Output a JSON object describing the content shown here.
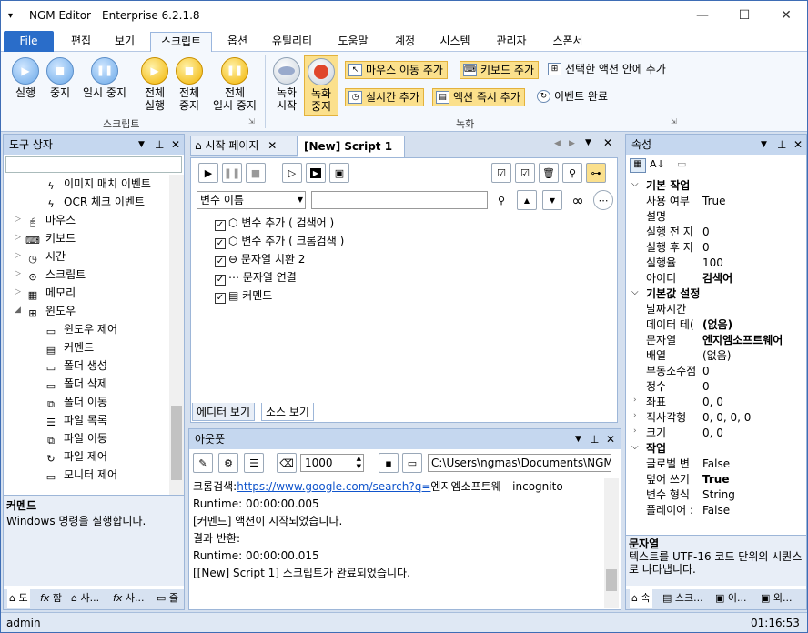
{
  "app": {
    "name": "NGM Editor",
    "edition": "Enterprise 6.2.1.8"
  },
  "menu": {
    "file": "File",
    "items": [
      "편집",
      "보기",
      "스크립트",
      "옵션",
      "유틸리티",
      "도움말",
      "계정",
      "시스템",
      "관리자",
      "스폰서"
    ],
    "active": "스크립트"
  },
  "ribbon": {
    "script_group": {
      "label": "스크립트",
      "buttons": [
        {
          "l1": "실행",
          "l2": ""
        },
        {
          "l1": "중지",
          "l2": ""
        },
        {
          "l1": "일시 중지",
          "l2": ""
        },
        {
          "l1": "전체",
          "l2": "실행"
        },
        {
          "l1": "전체",
          "l2": "중지"
        },
        {
          "l1": "전체",
          "l2": "일시 중지"
        }
      ]
    },
    "record_group": {
      "label": "녹화",
      "start": {
        "l1": "녹화",
        "l2": "시작"
      },
      "stop": {
        "l1": "녹화",
        "l2": "중지"
      },
      "small": [
        "마우스 이동 추가",
        "키보드 추가",
        "선택한 액션 안에 추가",
        "실시간 추가",
        "액션 즉시 추가",
        "이벤트 완료"
      ]
    }
  },
  "toolbox": {
    "title": "도구 상자",
    "items": [
      {
        "label": "이미지 매치 이벤트",
        "icon": "lightning-icon",
        "glyph": "ϟ"
      },
      {
        "label": "OCR 체크 이벤트",
        "icon": "lightning-icon",
        "glyph": "ϟ"
      },
      {
        "label": "마우스",
        "icon": "mouse-icon",
        "glyph": "🖰"
      },
      {
        "label": "키보드",
        "icon": "keyboard-icon",
        "glyph": "⌨"
      },
      {
        "label": "시간",
        "icon": "clock-icon",
        "glyph": "◷"
      },
      {
        "label": "스크립트",
        "icon": "script-icon",
        "glyph": "⊙"
      },
      {
        "label": "메모리",
        "icon": "memory-icon",
        "glyph": "▦"
      },
      {
        "label": "윈도우",
        "icon": "windows-icon",
        "glyph": "⊞"
      },
      {
        "label": "윈도우 제어",
        "icon": "window-control-icon",
        "glyph": "▭"
      },
      {
        "label": "커멘드",
        "icon": "cmd-icon",
        "glyph": "▤"
      },
      {
        "label": "폴더 생성",
        "icon": "folder-icon",
        "glyph": "▭"
      },
      {
        "label": "폴더 삭제",
        "icon": "folder-icon",
        "glyph": "▭"
      },
      {
        "label": "폴더 이동",
        "icon": "folder-move-icon",
        "glyph": "⧉"
      },
      {
        "label": "파일 목록",
        "icon": "file-list-icon",
        "glyph": "☰"
      },
      {
        "label": "파일 이동",
        "icon": "file-move-icon",
        "glyph": "⧉"
      },
      {
        "label": "파일 제어",
        "icon": "file-control-icon",
        "glyph": "↻"
      },
      {
        "label": "모니터 제어",
        "icon": "monitor-icon",
        "glyph": "▭"
      }
    ],
    "desc_title": "커멘드",
    "desc_text": "Windows 명령을 실행합니다.",
    "tabs": [
      "도",
      "함",
      "사...",
      "사...",
      "즐"
    ]
  },
  "editor": {
    "tabs": [
      "시작 페이지",
      "[New] Script 1"
    ],
    "var_select": "변수 이름",
    "actions": [
      "변수 추가 ( 검색어 )",
      "변수 추가 ( 크롬검색 )",
      "문자열 치환 2",
      "문자열 연결",
      "커멘드"
    ],
    "bottom_tabs": [
      "에디터 보기",
      "소스 보기"
    ]
  },
  "output": {
    "title": "아웃풋",
    "count": "1000",
    "path": "C:\\Users\\ngmas\\Documents\\NGM6\\",
    "line1_pre": "크롬검색:",
    "line1_link": "https://www.google.com/search?q=",
    "line1_post": "엔지엠소프트웨 --incognito",
    "lines": [
      "Runtime: 00:00:00.005",
      "[커멘드] 액션이 시작되었습니다.",
      "결과 반환:",
      "Runtime: 00:00:00.015",
      "[[New] Script 1] 스크립트가 완료되었습니다."
    ]
  },
  "props": {
    "title": "속성",
    "cat1": "기본 작업",
    "rows1": [
      {
        "k": "사용 여부",
        "v": "True"
      },
      {
        "k": "설명",
        "v": ""
      },
      {
        "k": "실행 전 지",
        "v": "0"
      },
      {
        "k": "실행 후 지",
        "v": "0"
      },
      {
        "k": "실행율",
        "v": "100"
      },
      {
        "k": "아이디",
        "v": "검색어"
      }
    ],
    "cat2": "기본값 설정",
    "rows2": [
      {
        "k": "날짜시간",
        "v": ""
      },
      {
        "k": "데이터 테(",
        "v": "(없음)"
      },
      {
        "k": "문자열",
        "v": "엔지엠소프트웨어"
      },
      {
        "k": "배열",
        "v": "(없음)"
      },
      {
        "k": "부동소수점",
        "v": "0"
      },
      {
        "k": "정수",
        "v": "0"
      },
      {
        "k": "좌표",
        "v": "0, 0"
      },
      {
        "k": "직사각형",
        "v": "0, 0, 0, 0"
      },
      {
        "k": "크기",
        "v": "0, 0"
      }
    ],
    "cat3": "작업",
    "rows3": [
      {
        "k": "글로벌 변",
        "v": "False"
      },
      {
        "k": "덮어 쓰기",
        "v": "True"
      },
      {
        "k": "변수 형식",
        "v": "String"
      },
      {
        "k": "플레이어 :",
        "v": "False"
      }
    ],
    "desc_title": "문자열",
    "desc_text": "텍스트를 UTF-16 코드 단위의 시퀀스로 나타냅니다.",
    "tabs": [
      "속",
      "스크...",
      "이...",
      "외..."
    ]
  },
  "status": {
    "user": "admin",
    "time": "01:16:53"
  }
}
